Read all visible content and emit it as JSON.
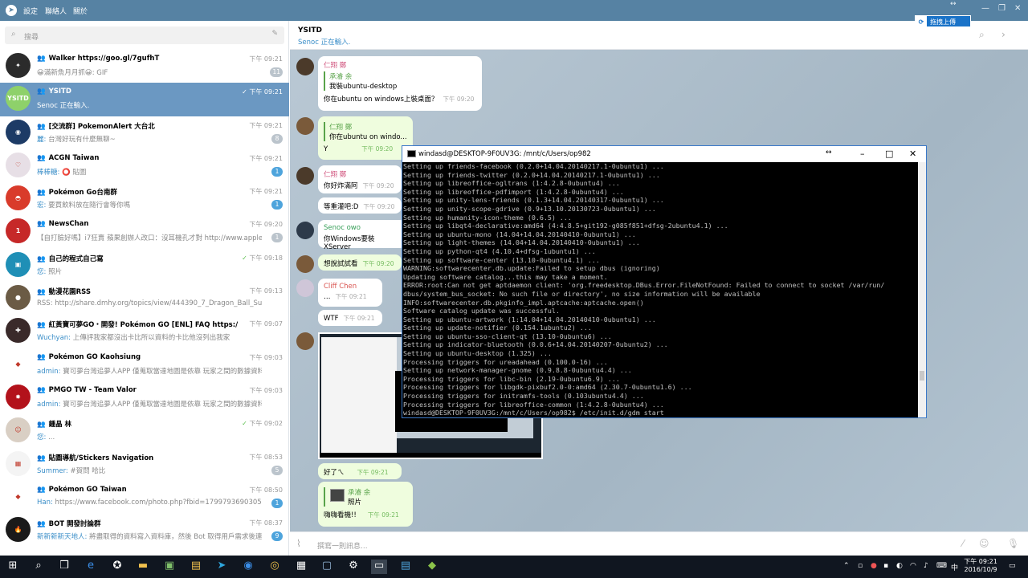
{
  "menu": {
    "settings": "設定",
    "contacts": "聯絡人",
    "about": "關於"
  },
  "search": {
    "placeholder": "搜尋"
  },
  "chats": [
    {
      "name": "Walker https://goo.gl/7gufhT",
      "time": "下午 09:21",
      "preview": "😀滿新魚月月抓😀: GIF",
      "badge": "11",
      "badge_style": "gray",
      "avatar_color": "#2b2b2b",
      "avatar_text": "✦"
    },
    {
      "name": "YSITD",
      "time": "下午 09:21",
      "preview": "Senoc 正在輸入.",
      "badge": "",
      "selected": true,
      "avatar_color": "#8ed16a",
      "avatar_text": "YSITD"
    },
    {
      "name": "[交流群] PokemonAlert 大台北",
      "time": "下午 09:21",
      "preview_who": "麗:",
      "preview": " 台灣好玩有什麼無聊~",
      "badge": "8",
      "badge_style": "gray",
      "avatar_color": "#1d3b66",
      "avatar_text": "◉"
    },
    {
      "name": "ACGN Taiwan",
      "time": "下午 09:21",
      "preview_who": "棒棒糖:",
      "preview": " ⭕ 貼圖",
      "badge": "1",
      "badge_style": "blue",
      "avatar_color": "#e7dfe6",
      "avatar_text": "♡"
    },
    {
      "name": "Pokémon Go台南群",
      "time": "下午 09:21",
      "preview_who": "宏:",
      "preview": " 要買飲料放在隨行會等你嗎",
      "badge": "1",
      "badge_style": "blue",
      "avatar_color": "#d93b2b",
      "avatar_text": "◓"
    },
    {
      "name": "NewsChan",
      "time": "下午 09:20",
      "preview": "【自打臉好嗎】i7狂賣 蘋果創辦人改口：沒耳機孔才對 http://www.appled...",
      "badge": "1",
      "badge_style": "gray",
      "avatar_color": "#c62828",
      "avatar_text": "1"
    },
    {
      "name": "自己的程式自己寫",
      "time": "下午 09:18",
      "preview_who": "您:",
      "preview": " 照片",
      "badge": "",
      "read": true,
      "avatar_color": "#1f8fb6",
      "avatar_text": "▣"
    },
    {
      "name": "動漫花園RSS",
      "time": "下午 09:13",
      "preview": "RSS: http://share.dmhy.org/topics/view/444390_7_Dragon_Ball_Super_61_B...",
      "badge": "",
      "avatar_color": "#6b5b45",
      "avatar_text": "●"
    },
    {
      "name": "紅黃寶可夢GO・開發! Pokémon GO [ENL] FAQ https://goo.gl...",
      "time": "下午 09:07",
      "preview_who": "Wuchyan:",
      "preview": " 上傳評我家都沒出卡比所以資料的卡比他沒列出我家",
      "badge": "",
      "avatar_color": "#3a2a2a",
      "avatar_text": "✚"
    },
    {
      "name": "Pokémon GO Kaohsiung",
      "time": "下午 09:03",
      "preview_who": "admin:",
      "preview": " 寶可夢台灣追夢人APP 僅蒐取當達地圖是依靠 玩家之間的數據資料互相...",
      "badge": "",
      "avatar_color": "#ffffff",
      "avatar_text": "◆"
    },
    {
      "name": "PMGO TW - Team Valor",
      "time": "下午 09:03",
      "preview_who": "admin:",
      "preview": " 寶可夢台灣追夢人APP 僅蒐取當達地圖是依靠 玩家之間的數據資料互相...",
      "badge": "",
      "avatar_color": "#b3121b",
      "avatar_text": "✸"
    },
    {
      "name": "鍾晶 林",
      "time": "下午 09:02",
      "preview_who": "您:",
      "preview": " ...",
      "badge": "",
      "read": true,
      "avatar_color": "#d9cfc4",
      "avatar_text": "☺"
    },
    {
      "name": "貼圖導航/Stickers Navigation",
      "time": "下午 08:53",
      "preview_who": "Summer:",
      "preview": " #賀問 哈比",
      "badge": "5",
      "badge_style": "gray",
      "avatar_color": "#f4f4f4",
      "avatar_text": "▦"
    },
    {
      "name": "Pokémon GO Taiwan",
      "time": "下午 08:50",
      "preview_who": "Han:",
      "preview": " https://www.facebook.com/photo.php?fbid=1799793690305166&s...",
      "badge": "1",
      "badge_style": "blue",
      "avatar_color": "#ffffff",
      "avatar_text": "◆"
    },
    {
      "name": "BOT 開發討論群",
      "time": "下午 08:37",
      "preview_who": "新新新新天地人:",
      "preview": " 將盡取得的資料寫入資料庫，然後 Bot 取得用戶需求後連...",
      "badge": "9",
      "badge_style": "blue",
      "avatar_color": "#1a1a1a",
      "avatar_text": "🔥"
    }
  ],
  "chat_header": {
    "title": "YSITD",
    "status": "Senoc 正在輸入."
  },
  "messages": {
    "m1": {
      "sender": "仁翔 鄭",
      "quote_name": "承濬 余",
      "quote_text": "我裝ubuntu-desktop",
      "text": "你在ubuntu on windows上裝桌面？",
      "time": "下午 09:20"
    },
    "m2": {
      "quote_name": "仁翔 鄭",
      "quote_text": "你在ubuntu on windo...",
      "text": "Y",
      "time": "下午 09:20"
    },
    "m3": {
      "sender": "仁翔 鄭",
      "text": "你好炸滿阿",
      "time": "下午 09:20"
    },
    "m4": {
      "text": "等重灌吧:D",
      "time": "下午 09:20"
    },
    "m5": {
      "sender": "Senoc owo",
      "text": "你Windows要裝XServer",
      "time": ""
    },
    "m6": {
      "text": "想說試試看",
      "time": "下午 09:20"
    },
    "m7": {
      "sender": "Cliff Chen",
      "text": "…",
      "time": "下午 09:21"
    },
    "m8": {
      "text": "WTF",
      "time": "下午 09:21"
    },
    "m9": {
      "text": "好了ㄟ",
      "time": "下午 09:21"
    },
    "m10": {
      "quote_name": "承濬 余",
      "quote_text": "照片",
      "text": "嗨嗨看機!!",
      "time": "下午 09:21"
    }
  },
  "composer": {
    "placeholder": "撰寫一則訊息..."
  },
  "upload_button": {
    "label": "拖拽上傳"
  },
  "terminal": {
    "title": "windasd@DESKTOP-9F0UV3G: /mnt/c/Users/op982",
    "output": "Setting up friends-facebook (0.2.0+14.04.20140217.1-0ubuntu1) ...\nSetting up friends-twitter (0.2.0+14.04.20140217.1-0ubuntu1) ...\nSetting up libreoffice-ogltrans (1:4.2.8-0ubuntu4) ...\nSetting up libreoffice-pdfimport (1:4.2.8-0ubuntu4) ...\nSetting up unity-lens-friends (0.1.3+14.04.20140317-0ubuntu1) ...\nSetting up unity-scope-gdrive (0.9+13.10.20130723-0ubuntu1) ...\nSetting up humanity-icon-theme (0.6.5) ...\nSetting up libqt4-declarative:amd64 (4:4.8.5+git192-g085f851+dfsg-2ubuntu4.1) ...\nSetting up ubuntu-mono (14.04+14.04.20140410-0ubuntu1) ...\nSetting up light-themes (14.04+14.04.20140410-0ubuntu1) ...\nSetting up python-qt4 (4.10.4+dfsg-1ubuntu1) ...\nSetting up software-center (13.10-0ubuntu4.1) ...\nWARNING:softwarecenter.db.update:Failed to setup dbus (ignoring)\nUpdating software catalog...this may take a moment.\nERROR:root:Can not get aptdaemon client: 'org.freedesktop.DBus.Error.FileNotFound: Failed to connect to socket /var/run/\ndbus/system_bus_socket: No such file or directory', no size information will be available\nINFO:softwarecenter.db.pkginfo_impl.aptcache:aptcache.open()\nSoftware catalog update was successful.\nSetting up ubuntu-artwork (1:14.04+14.04.20140410-0ubuntu1) ...\nSetting up update-notifier (0.154.1ubuntu2) ...\nSetting up ubuntu-sso-client-qt (13.10-0ubuntu6) ...\nSetting up indicator-bluetooth (0.0.6+14.04.20140207-0ubuntu2) ...\nSetting up ubuntu-desktop (1.325) ...\nProcessing triggers for ureadahead (0.100.0-16) ...\nSetting up network-manager-gnome (0.9.8.8-0ubuntu4.4) ...\nProcessing triggers for libc-bin (2.19-0ubuntu6.9) ...\nProcessing triggers for libgdk-pixbuf2.0-0:amd64 (2.30.7-0ubuntu1.6) ...\nProcessing triggers for initramfs-tools (0.103ubuntu4.4) ...\nProcessing triggers for libreoffice-common (1:4.2.8-0ubuntu4) ...\nwindasd@DESKTOP-9F0UV3G:/mnt/c/Users/op982$ /etc/init.d/gdm start"
  },
  "taskbar": {
    "time": "下午 09:21",
    "date": "2016/10/9"
  }
}
